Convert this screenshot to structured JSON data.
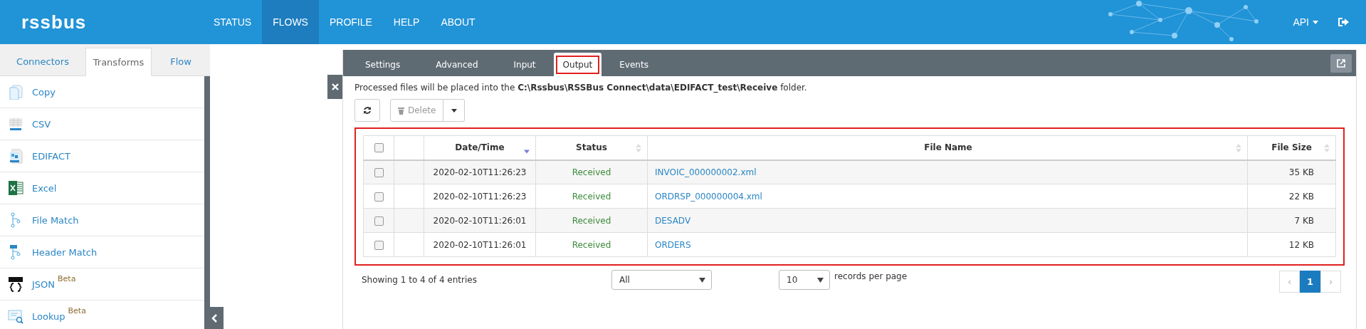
{
  "header": {
    "logo": "rssbus",
    "nav": [
      {
        "label": "STATUS",
        "selected": false
      },
      {
        "label": "FLOWS",
        "selected": true
      },
      {
        "label": "PROFILE",
        "selected": false
      },
      {
        "label": "HELP",
        "selected": false
      },
      {
        "label": "ABOUT",
        "selected": false
      }
    ],
    "user_menu": "API"
  },
  "sidebar": {
    "tabs": [
      {
        "label": "Connectors",
        "selected": false
      },
      {
        "label": "Transforms",
        "selected": true
      },
      {
        "label": "Flow",
        "selected": false
      }
    ],
    "items": [
      {
        "label": "Copy"
      },
      {
        "label": "CSV"
      },
      {
        "label": "EDIFACT"
      },
      {
        "label": "Excel"
      },
      {
        "label": "File Match"
      },
      {
        "label": "Header Match"
      },
      {
        "label": "JSON",
        "badge": "Beta"
      },
      {
        "label": "Lookup",
        "badge": "Beta"
      }
    ]
  },
  "panel": {
    "tabs": [
      {
        "label": "Settings",
        "selected": false,
        "highlighted": false
      },
      {
        "label": "Advanced",
        "selected": false,
        "highlighted": false
      },
      {
        "label": "Input",
        "selected": false,
        "highlighted": false
      },
      {
        "label": "Output",
        "selected": true,
        "highlighted": true
      },
      {
        "label": "Events",
        "selected": false,
        "highlighted": false
      }
    ],
    "info": "Processed files will be placed into the **C:\\Rssbus\\RSSBus Connect\\data\\EDIFACT_test\\Receive** folder.",
    "toolbar": {
      "delete": {
        "label": "Delete",
        "disabled": true
      }
    },
    "table": {
      "highlighted": true,
      "select_all_checked": false,
      "columns": [
        {
          "label": "Date/Time",
          "sorted_descending": true
        },
        {
          "label": "Status",
          "sorted_descending": false
        },
        {
          "label": "File Name",
          "sorted_descending": false
        },
        {
          "label": "File Size",
          "sorted_descending": false
        }
      ],
      "rows": [
        {
          "checked": false,
          "date": "2020-02-10T11:26:23",
          "status": "Received",
          "file": "INVOIC_000000002.xml",
          "size": "35 KB"
        },
        {
          "checked": false,
          "date": "2020-02-10T11:26:23",
          "status": "Received",
          "file": "ORDRSP_000000004.xml",
          "size": "22 KB"
        },
        {
          "checked": false,
          "date": "2020-02-10T11:26:01",
          "status": "Received",
          "file": "DESADV",
          "size": "7 KB"
        },
        {
          "checked": false,
          "date": "2020-02-10T11:26:01",
          "status": "Received",
          "file": "ORDERS",
          "size": "12 KB"
        }
      ]
    },
    "footer": {
      "summary": "Showing 1 to 4 of 4 entries",
      "filter": "All",
      "page_size": "10",
      "page_size_label": "records per page",
      "pagination": {
        "prev": "‹",
        "pages": [
          {
            "label": "1",
            "selected": true
          }
        ],
        "next": "›"
      }
    }
  }
}
